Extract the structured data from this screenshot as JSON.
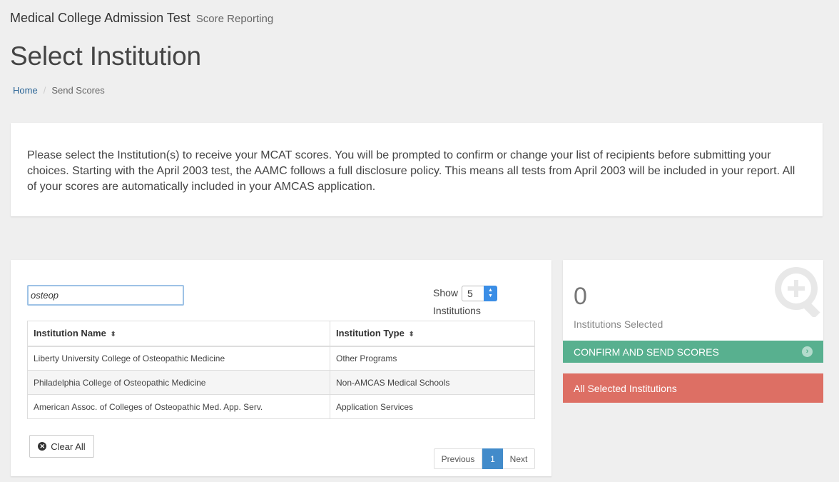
{
  "header": {
    "app_title": "Medical College Admission Test",
    "app_subtitle": "Score Reporting"
  },
  "page_title": "Select Institution",
  "breadcrumb": {
    "home": "Home",
    "separator": "/",
    "current": "Send Scores"
  },
  "intro_text": "Please select the Institution(s) to receive your MCAT scores. You will be prompted to confirm or change your list of recipients before submitting your choices. Starting with the April 2003 test, the AAMC follows a full disclosure policy. This means all tests from April 2003 will be included in your report. All of your scores are automatically included in your AMCAS application.",
  "search": {
    "value": "osteop"
  },
  "show": {
    "label": "Show",
    "value": "5",
    "suffix": "Institutions"
  },
  "table": {
    "columns": [
      "Institution Name",
      "Institution Type"
    ],
    "rows": [
      {
        "name": "Liberty University College of Osteopathic Medicine",
        "type": "Other Programs"
      },
      {
        "name": "Philadelphia College of Osteopathic Medicine",
        "type": "Non-AMCAS Medical Schools"
      },
      {
        "name": "American Assoc. of Colleges of Osteopathic Med. App. Serv.",
        "type": "Application Services"
      }
    ]
  },
  "clear_all_label": "Clear All",
  "pagination": {
    "previous": "Previous",
    "current_page": "1",
    "next": "Next"
  },
  "summary": {
    "count": "0",
    "count_label": "Institutions Selected",
    "confirm_label": "CONFIRM AND SEND SCORES",
    "selected_label": "All Selected Institutions"
  },
  "colors": {
    "confirm": "#58b08f",
    "selected": "#dd6f64",
    "page_active": "#428bca"
  },
  "icons": {
    "sort": "sort-icon",
    "clear": "close-circle-icon",
    "confirm_arrow": "arrow-circle-right-icon",
    "summary": "zoom-in-icon"
  }
}
